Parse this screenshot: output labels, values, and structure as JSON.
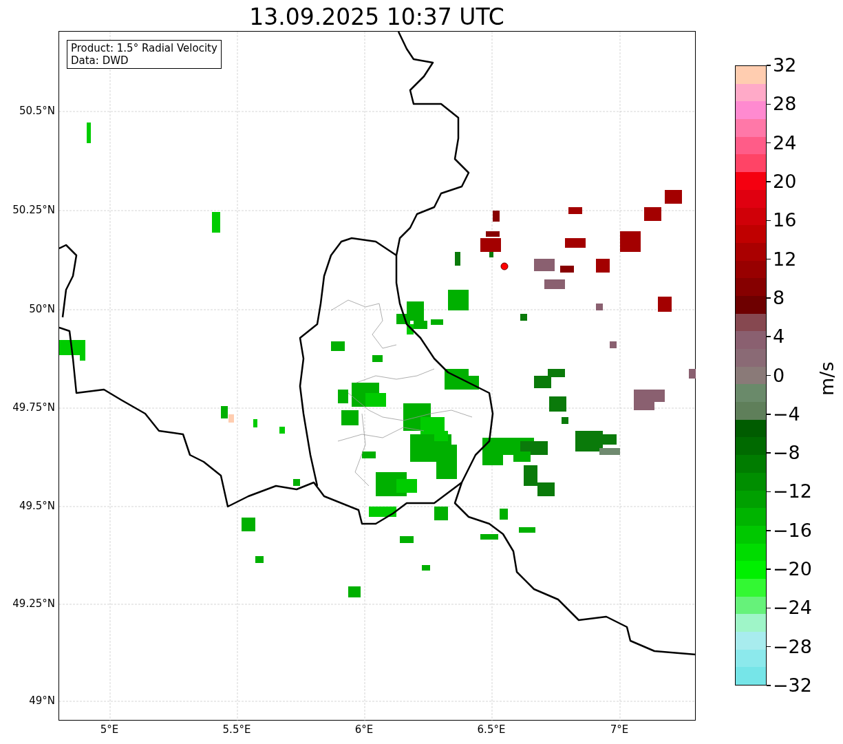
{
  "title": "13.09.2025 10:37 UTC",
  "map": {
    "legend": [
      "Product: 1.5° Radial Velocity",
      "Data: DWD"
    ],
    "lat_labels": [
      "50.5°N",
      "50.25°N",
      "50°N",
      "49.75°N",
      "49.5°N",
      "49.25°N",
      "49°N"
    ],
    "lon_labels": [
      "5°E",
      "5.5°E",
      "6°E",
      "6.5°E",
      "7°E"
    ]
  },
  "colorbar": {
    "label": "m/s",
    "ticks": [
      "32",
      "28",
      "24",
      "20",
      "16",
      "12",
      "8",
      "4",
      "0",
      "−4",
      "−8",
      "−12",
      "−16",
      "−20",
      "−24",
      "−28",
      "−32"
    ],
    "bands": [
      {
        "color": "#ffcdb0"
      },
      {
        "color": "#ffaac8"
      },
      {
        "color": "#ff8ad0"
      },
      {
        "color": "#ff78a8"
      },
      {
        "color": "#ff5c88"
      },
      {
        "color": "#ff4466"
      },
      {
        "color": "#f50010"
      },
      {
        "color": "#e00010"
      },
      {
        "color": "#d00008"
      },
      {
        "color": "#c00000"
      },
      {
        "color": "#aa0000"
      },
      {
        "color": "#980000"
      },
      {
        "color": "#860000"
      },
      {
        "color": "#6e0000"
      },
      {
        "color": "#864850"
      },
      {
        "color": "#8a6070"
      },
      {
        "color": "#8a6a75"
      },
      {
        "color": "#8a7a78"
      },
      {
        "color": "#6a8a6a"
      },
      {
        "color": "#5f7f5a"
      },
      {
        "color": "#005c00"
      },
      {
        "color": "#006a00"
      },
      {
        "color": "#007c00"
      },
      {
        "color": "#008e00"
      },
      {
        "color": "#00a000"
      },
      {
        "color": "#00b400"
      },
      {
        "color": "#00c800"
      },
      {
        "color": "#00dc00"
      },
      {
        "color": "#00f000"
      },
      {
        "color": "#33f833"
      },
      {
        "color": "#66f27a"
      },
      {
        "color": "#9ff5c8"
      },
      {
        "color": "#a8ecee"
      },
      {
        "color": "#8ce9ec"
      },
      {
        "color": "#76e5e8"
      }
    ]
  }
}
